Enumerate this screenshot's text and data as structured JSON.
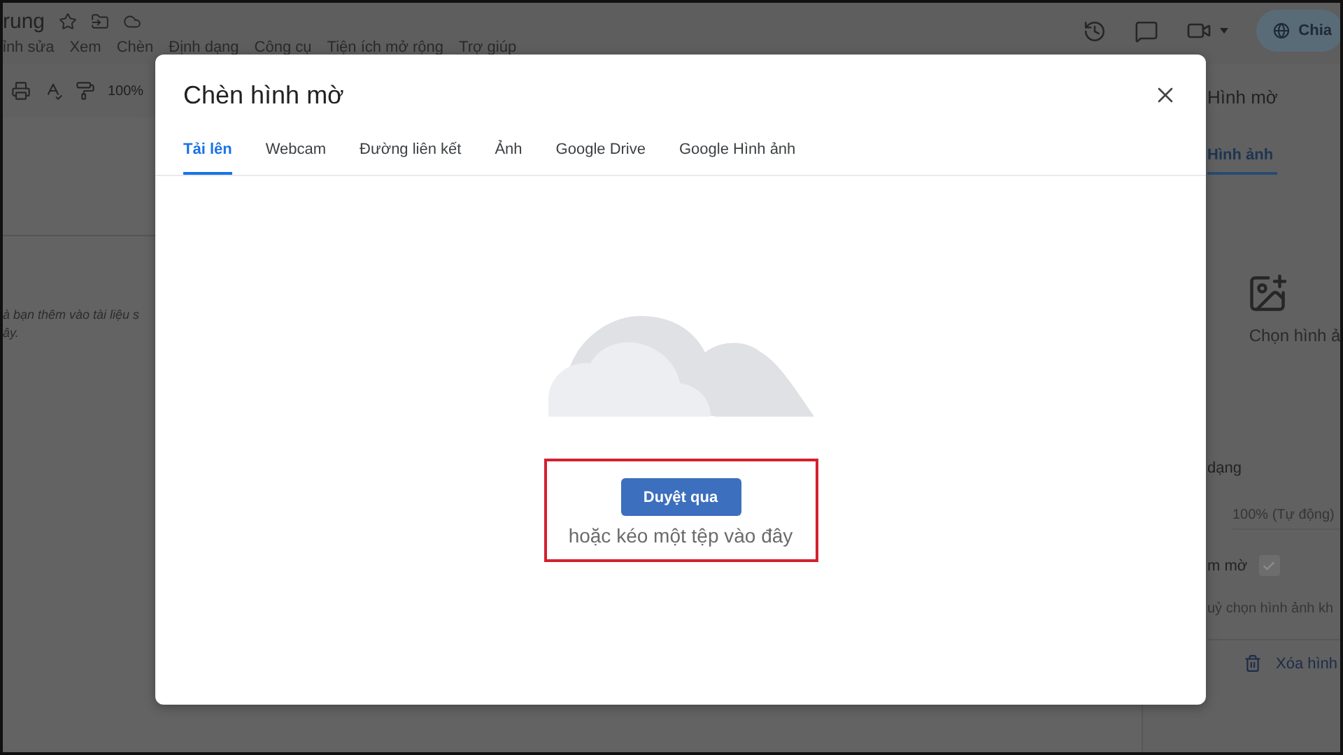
{
  "app": {
    "doc_title": "rung",
    "menus": [
      "ỉnh sửa",
      "Xem",
      "Chèn",
      "Định dạng",
      "Công cụ",
      "Tiện ích mở rộng",
      "Trợ giúp"
    ],
    "share_button": "Chia",
    "zoom": "100%"
  },
  "document": {
    "lines": [
      "à bạn thêm vào tài liệu s",
      "ây."
    ]
  },
  "side_panel": {
    "title": "Hình mờ",
    "tab": "Hình ảnh",
    "choose_image": "Chọn hình ả",
    "section_label": "dạng",
    "scale_field": "100% (Tự động)",
    "fade_label": "m mờ",
    "fade_checked": true,
    "hint": "uỷ chọn hình ảnh kh",
    "remove_button": "Xóa hình"
  },
  "dialog": {
    "title": "Chèn hình mờ",
    "tabs": [
      {
        "label": "Tải lên",
        "selected": true
      },
      {
        "label": "Webcam",
        "selected": false
      },
      {
        "label": "Đường liên kết",
        "selected": false
      },
      {
        "label": "Ảnh",
        "selected": false
      },
      {
        "label": "Google Drive",
        "selected": false
      },
      {
        "label": "Google Hình ảnh",
        "selected": false
      }
    ],
    "browse_button": "Duyệt qua",
    "drop_hint": "hoặc kéo một tệp vào đây"
  }
}
